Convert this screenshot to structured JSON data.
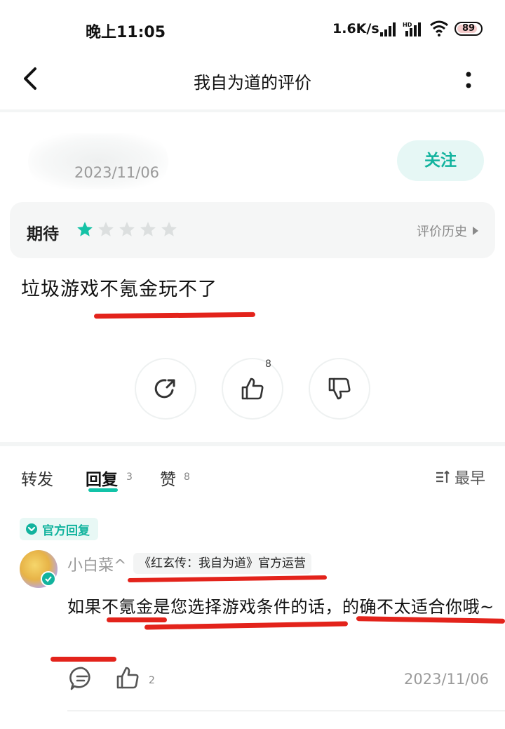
{
  "status_bar": {
    "time": "晚上11:05",
    "net_speed": "1.6K/s",
    "battery": "89"
  },
  "nav": {
    "title": "我自为道的评价"
  },
  "post": {
    "date": "2023/11/06",
    "follow_label": "关注",
    "rating_label": "期待",
    "rating_value": 1,
    "rating_max": 5,
    "history_label": "评价历史",
    "review_text": "垃圾游戏不氪金玩不了",
    "like_count": "8"
  },
  "tabs": [
    {
      "label": "转发",
      "count": ""
    },
    {
      "label": "回复",
      "count": "3"
    },
    {
      "label": "赞",
      "count": "8"
    }
  ],
  "sort_label": "最早",
  "reply": {
    "badge_label": "官方回复",
    "user_name": "小白菜^",
    "user_tag": "《红玄传：我自为道》官方运营",
    "text": "如果不氪金是您选择游戏条件的话，的确不太适合你哦~",
    "like_count": "2",
    "date": "2023/11/06"
  },
  "colors": {
    "accent": "#12b39e",
    "annotation_red": "#e3231b"
  }
}
